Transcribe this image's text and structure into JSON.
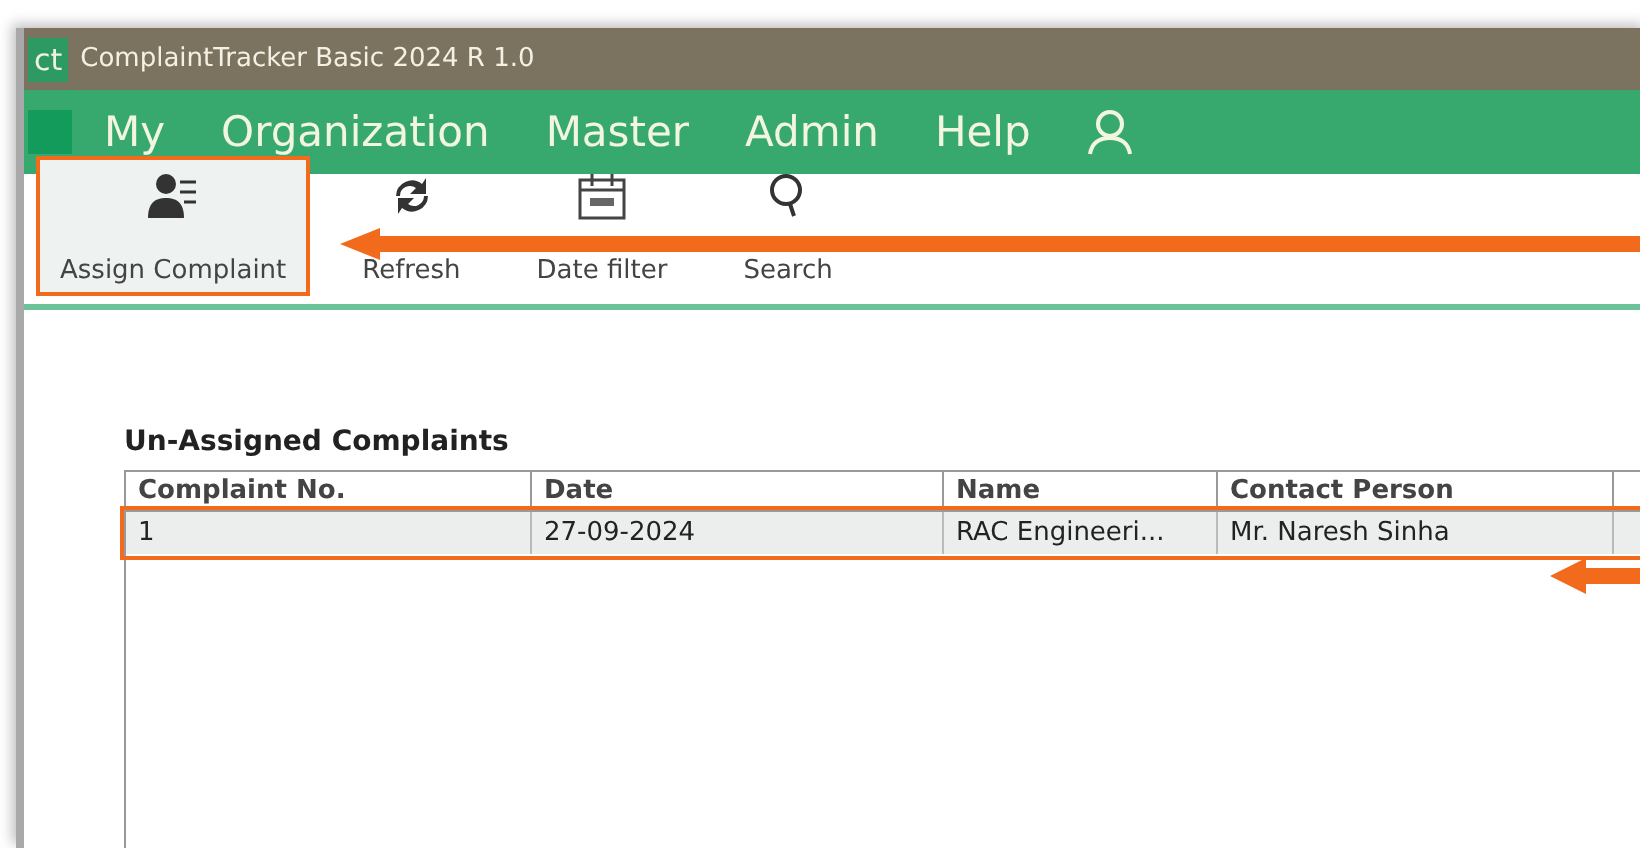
{
  "window": {
    "logo": "ct",
    "title": "ComplaintTracker Basic 2024 R 1.0"
  },
  "menu": [
    "My",
    "Organization",
    "Master",
    "Admin",
    "Help"
  ],
  "toolbar": [
    {
      "label": "Assign Complaint",
      "kind": "assign",
      "selected": true
    },
    {
      "label": "Refresh",
      "kind": "refresh",
      "selected": false
    },
    {
      "label": "Date filter",
      "kind": "calendar",
      "selected": false
    },
    {
      "label": "Search",
      "kind": "search",
      "selected": false
    }
  ],
  "table": {
    "title": "Un-Assigned Complaints",
    "columns": [
      "Complaint No.",
      "Date",
      "Name",
      "Contact Person"
    ],
    "rows": [
      {
        "cells": [
          "1",
          "27-09-2024",
          "RAC Engineeri...",
          "Mr. Naresh Sinha"
        ],
        "selected": true
      }
    ]
  }
}
